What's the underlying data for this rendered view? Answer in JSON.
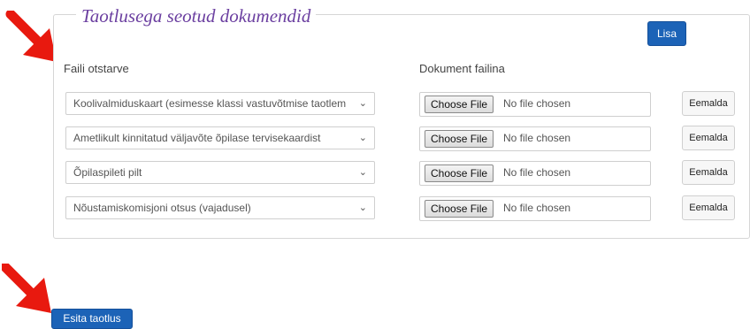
{
  "section": {
    "title": "Taotlusega seotud dokumendid",
    "add_label": "Lisa",
    "col_file_choice": "Faili otstarve",
    "col_document": "Dokument failina"
  },
  "rows": [
    {
      "select_value": "Koolivalmiduskaart (esimesse klassi vastuvõtmise taotlem",
      "choose_label": "Choose File",
      "file_status": "No file chosen",
      "remove_label": "Eemalda"
    },
    {
      "select_value": "Ametlikult kinnitatud väljavõte õpilase tervisekaardist",
      "choose_label": "Choose File",
      "file_status": "No file chosen",
      "remove_label": "Eemalda"
    },
    {
      "select_value": "Õpilaspileti pilt",
      "choose_label": "Choose File",
      "file_status": "No file chosen",
      "remove_label": "Eemalda"
    },
    {
      "select_value": "Nõustamiskomisjoni otsus (vajadusel)",
      "choose_label": "Choose File",
      "file_status": "No file chosen",
      "remove_label": "Eemalda"
    }
  ],
  "submit_label": "Esita taotlus",
  "colors": {
    "primary": "#1c63b7",
    "title": "#6b3fa0",
    "arrow": "#e8190f"
  },
  "icons": {
    "select_chevron": "chevron-down-icon",
    "annotation": "red-arrow-icon"
  }
}
